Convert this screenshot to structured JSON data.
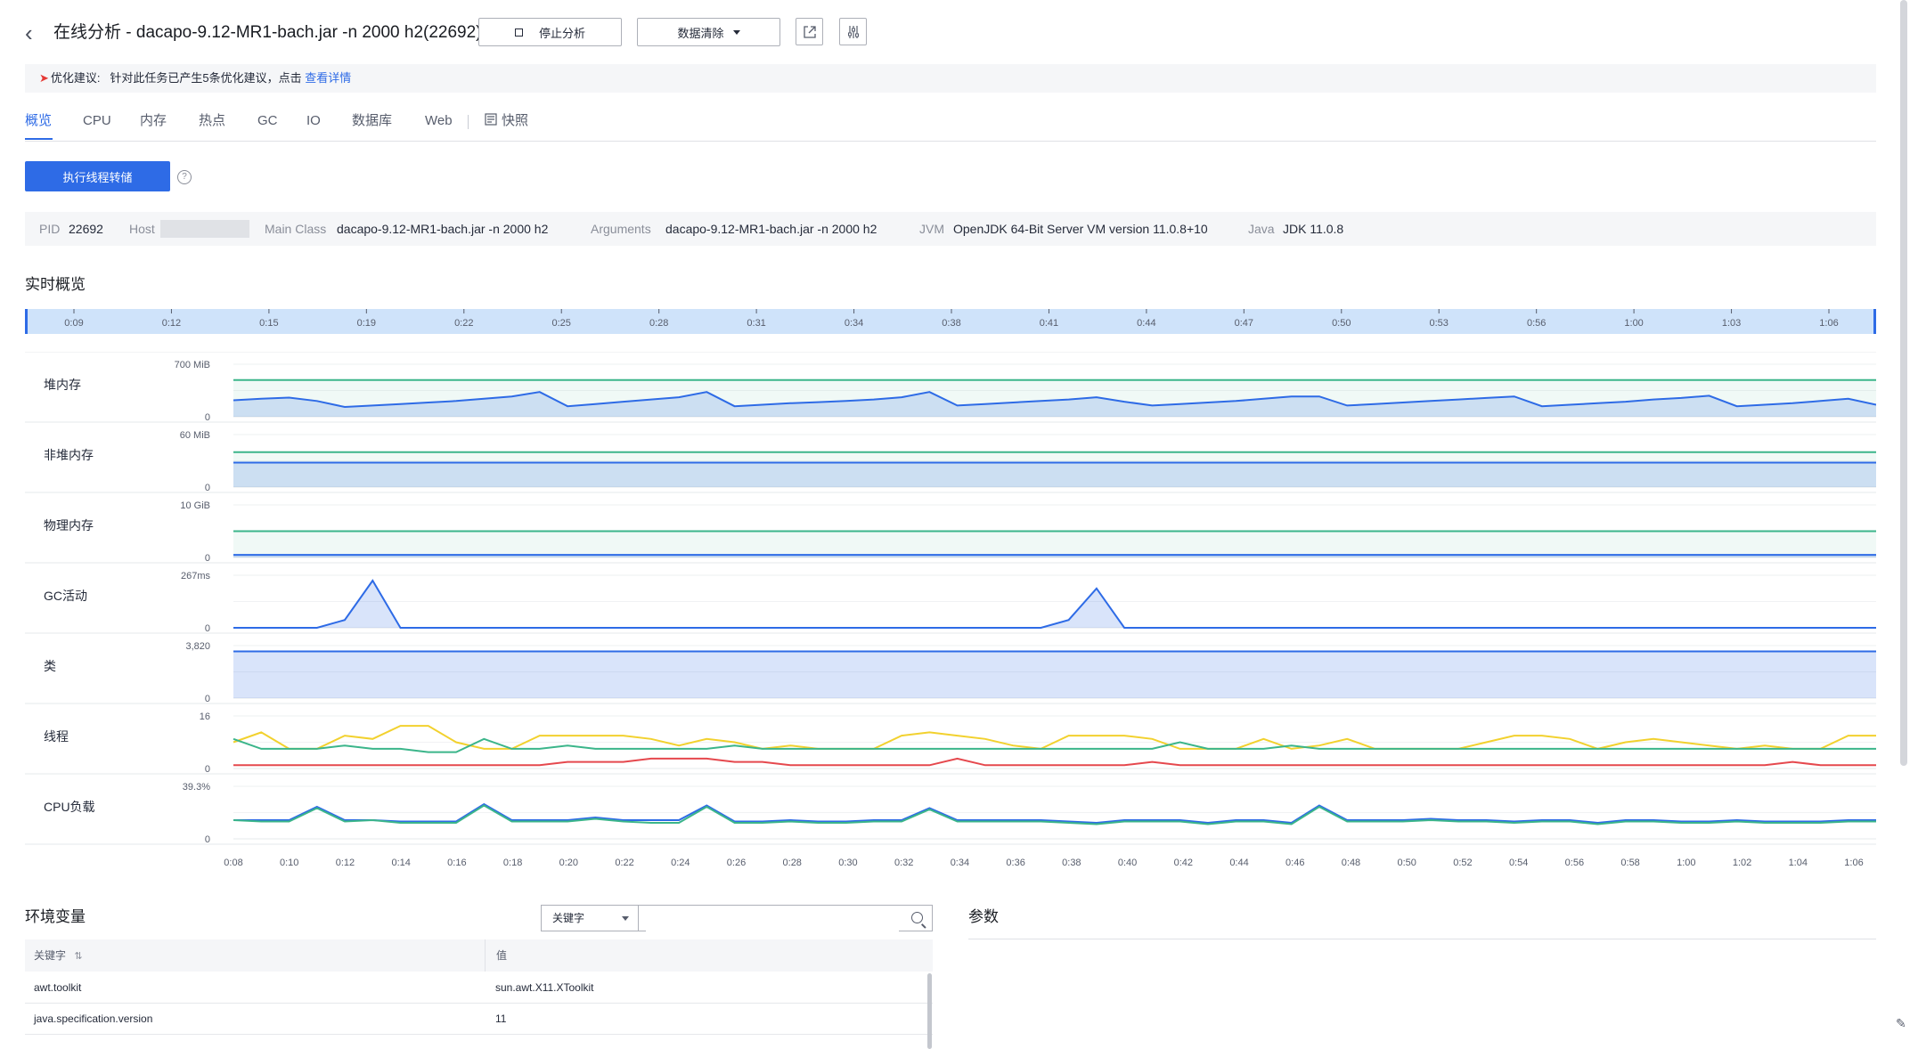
{
  "header": {
    "title": "在线分析 - dacapo-9.12-MR1-bach.jar -n 2000 h2(22692)",
    "stop_label": "停止分析",
    "clear_label": "数据清除",
    "icon_names": [
      "back-icon",
      "external-link-icon",
      "settings-sliders-icon"
    ]
  },
  "suggestion": {
    "prefix": "优化建议:",
    "text": "针对此任务已产生5条优化建议，点击",
    "link": "查看详情"
  },
  "tabs": [
    {
      "label": "概览",
      "active": true
    },
    {
      "label": "CPU"
    },
    {
      "label": "内存"
    },
    {
      "label": "热点"
    },
    {
      "label": "GC"
    },
    {
      "label": "IO"
    },
    {
      "label": "数据库"
    },
    {
      "label": "Web"
    },
    {
      "label": "快照"
    }
  ],
  "thread_dump_label": "执行线程转储",
  "help_glyph": "?",
  "info": {
    "pid_label": "PID",
    "pid": "22692",
    "host_label": "Host",
    "main_class_label": "Main Class",
    "main_class": "dacapo-9.12-MR1-bach.jar -n 2000 h2",
    "arguments_label": "Arguments",
    "arguments": "dacapo-9.12-MR1-bach.jar -n 2000 h2",
    "jvm_label": "JVM",
    "jvm": "OpenJDK 64-Bit Server VM version 11.0.8+10",
    "java_label": "Java",
    "java": "JDK 11.0.8"
  },
  "realtime_title": "实时概览",
  "timeline_ticks": [
    "0:09",
    "0:12",
    "0:15",
    "0:19",
    "0:22",
    "0:25",
    "0:28",
    "0:31",
    "0:34",
    "0:38",
    "0:41",
    "0:44",
    "0:47",
    "0:50",
    "0:53",
    "0:56",
    "1:00",
    "1:03",
    "1:06"
  ],
  "x_ticks": [
    "0:08",
    "0:10",
    "0:12",
    "0:14",
    "0:16",
    "0:18",
    "0:20",
    "0:22",
    "0:24",
    "0:26",
    "0:28",
    "0:30",
    "0:32",
    "0:34",
    "0:36",
    "0:38",
    "0:40",
    "0:42",
    "0:44",
    "0:46",
    "0:48",
    "0:50",
    "0:52",
    "0:54",
    "0:56",
    "0:58",
    "1:00",
    "1:02",
    "1:04",
    "1:06"
  ],
  "colors": {
    "blue": "#2e6be6",
    "green": "#3bb58a",
    "yellow": "#f2d12e",
    "red": "#e5484d"
  },
  "chart_data": [
    {
      "type": "area",
      "title": "堆内存",
      "ymax": "700 MiB",
      "ymin": "0",
      "ylim": [
        0,
        700
      ],
      "series": [
        {
          "color": "green",
          "values": [
            490,
            490,
            490,
            490,
            490,
            490,
            490,
            490,
            490,
            490,
            490,
            490,
            490,
            490,
            490,
            490,
            490,
            490,
            490,
            490,
            490,
            490,
            490,
            490,
            490,
            490,
            490,
            490,
            490,
            490,
            490,
            490,
            490,
            490,
            490,
            490,
            490,
            490,
            490,
            490,
            490,
            490,
            490,
            490,
            490,
            490,
            490,
            490,
            490,
            490,
            490,
            490,
            490,
            490,
            490,
            490,
            490,
            490,
            490,
            490
          ]
        },
        {
          "color": "blue",
          "values": [
            220,
            240,
            255,
            210,
            130,
            150,
            170,
            190,
            210,
            240,
            270,
            330,
            140,
            170,
            200,
            230,
            260,
            330,
            140,
            160,
            180,
            195,
            210,
            230,
            260,
            330,
            150,
            170,
            190,
            210,
            230,
            260,
            200,
            150,
            170,
            190,
            210,
            240,
            270,
            270,
            150,
            170,
            190,
            210,
            230,
            250,
            270,
            140,
            160,
            180,
            200,
            230,
            250,
            280,
            140,
            160,
            180,
            210,
            240,
            160
          ]
        }
      ]
    },
    {
      "type": "area",
      "title": "非堆内存",
      "ymax": "60 MiB",
      "ymin": "0",
      "ylim": [
        0,
        60
      ],
      "series": [
        {
          "color": "green",
          "values": [
            40,
            40,
            40,
            40,
            40,
            40,
            40,
            40,
            40,
            40,
            40,
            40,
            40,
            40,
            40,
            40,
            40,
            40,
            40,
            40,
            40,
            40,
            40,
            40,
            40,
            40,
            40,
            40,
            40,
            40,
            40,
            40,
            40,
            40,
            40,
            40,
            40,
            40,
            40,
            40,
            40,
            40,
            40,
            40,
            40,
            40,
            40,
            40,
            40,
            40,
            40,
            40,
            40,
            40,
            40,
            40,
            40,
            40,
            40,
            40
          ]
        },
        {
          "color": "blue",
          "values": [
            28,
            28,
            28,
            28,
            28,
            28,
            28,
            28,
            28,
            28,
            28,
            28,
            28,
            28,
            28,
            28,
            28,
            28,
            28,
            28,
            28,
            28,
            28,
            28,
            28,
            28,
            28,
            28,
            28,
            28,
            28,
            28,
            28,
            28,
            28,
            28,
            28,
            28,
            28,
            28,
            28,
            28,
            28,
            28,
            28,
            28,
            28,
            28,
            28,
            28,
            28,
            28,
            28,
            28,
            28,
            28,
            28,
            28,
            28,
            28
          ]
        }
      ]
    },
    {
      "type": "area",
      "title": "物理内存",
      "ymax": "10 GiB",
      "ymin": "0",
      "ylim": [
        0,
        10
      ],
      "series": [
        {
          "color": "green",
          "values": [
            5,
            5,
            5,
            5,
            5,
            5,
            5,
            5,
            5,
            5,
            5,
            5,
            5,
            5,
            5,
            5,
            5,
            5,
            5,
            5,
            5,
            5,
            5,
            5,
            5,
            5,
            5,
            5,
            5,
            5,
            5,
            5,
            5,
            5,
            5,
            5,
            5,
            5,
            5,
            5,
            5,
            5,
            5,
            5,
            5,
            5,
            5,
            5,
            5,
            5,
            5,
            5,
            5,
            5,
            5,
            5,
            5,
            5,
            5,
            5
          ]
        },
        {
          "color": "blue",
          "values": [
            0.5,
            0.5,
            0.5,
            0.5,
            0.5,
            0.5,
            0.5,
            0.5,
            0.5,
            0.5,
            0.5,
            0.5,
            0.5,
            0.5,
            0.5,
            0.5,
            0.5,
            0.5,
            0.5,
            0.5,
            0.5,
            0.5,
            0.5,
            0.5,
            0.5,
            0.5,
            0.5,
            0.5,
            0.5,
            0.5,
            0.5,
            0.5,
            0.5,
            0.5,
            0.5,
            0.5,
            0.5,
            0.5,
            0.5,
            0.5,
            0.5,
            0.5,
            0.5,
            0.5,
            0.5,
            0.5,
            0.5,
            0.5,
            0.5,
            0.5,
            0.5,
            0.5,
            0.5,
            0.5,
            0.5,
            0.5,
            0.5,
            0.5,
            0.5,
            0.5
          ]
        }
      ]
    },
    {
      "type": "area",
      "title": "GC活动",
      "ymax": "267ms",
      "ymin": "0",
      "ylim": [
        0,
        267
      ],
      "series": [
        {
          "color": "blue",
          "values": [
            0,
            0,
            0,
            0,
            40,
            240,
            0,
            0,
            0,
            0,
            0,
            0,
            0,
            0,
            0,
            0,
            0,
            0,
            0,
            0,
            0,
            0,
            0,
            0,
            0,
            0,
            0,
            0,
            0,
            0,
            40,
            200,
            0,
            0,
            0,
            0,
            0,
            0,
            0,
            0,
            0,
            0,
            0,
            0,
            0,
            0,
            0,
            0,
            0,
            0,
            0,
            0,
            0,
            0,
            0,
            0,
            0,
            0,
            0,
            0
          ]
        }
      ]
    },
    {
      "type": "area",
      "title": "类",
      "ymax": "3,820",
      "ymin": "0",
      "ylim": [
        0,
        3820
      ],
      "series": [
        {
          "color": "blue",
          "values": [
            3400,
            3400
          ]
        }
      ]
    },
    {
      "type": "line",
      "title": "线程",
      "ymax": "16",
      "ymin": "0",
      "ylim": [
        0,
        16
      ],
      "series": [
        {
          "color": "yellow",
          "values": [
            8,
            11,
            6,
            6,
            10,
            9,
            13,
            13,
            8,
            6,
            6,
            10,
            10,
            10,
            10,
            9,
            7,
            9,
            8,
            6,
            7,
            6,
            6,
            6,
            10,
            11,
            10,
            9,
            7,
            6,
            10,
            10,
            10,
            9,
            6,
            6,
            6,
            9,
            6,
            7,
            9,
            6,
            6,
            6,
            6,
            8,
            10,
            10,
            9,
            6,
            8,
            9,
            8,
            7,
            6,
            7,
            6,
            6,
            10,
            10
          ]
        },
        {
          "color": "green",
          "values": [
            9,
            6,
            6,
            6,
            7,
            6,
            6,
            5,
            5,
            9,
            6,
            6,
            7,
            6,
            6,
            6,
            6,
            6,
            7,
            6,
            6,
            6,
            6,
            6,
            6,
            6,
            6,
            6,
            6,
            6,
            6,
            6,
            6,
            6,
            8,
            6,
            6,
            6,
            7,
            6,
            6,
            6,
            6,
            6,
            6,
            6,
            6,
            6,
            6,
            6,
            6,
            6,
            6,
            6,
            6,
            6,
            6,
            6,
            6,
            6
          ]
        },
        {
          "color": "red",
          "values": [
            1,
            1,
            1,
            1,
            1,
            1,
            1,
            1,
            1,
            1,
            1,
            1,
            2,
            2,
            2,
            3,
            3,
            3,
            2,
            2,
            1,
            1,
            1,
            1,
            1,
            1,
            3,
            1,
            1,
            1,
            1,
            1,
            1,
            2,
            1,
            1,
            1,
            1,
            1,
            1,
            1,
            1,
            1,
            1,
            1,
            1,
            1,
            1,
            1,
            1,
            1,
            1,
            1,
            1,
            1,
            1,
            2,
            1,
            1,
            1
          ]
        }
      ]
    },
    {
      "type": "line",
      "title": "CPU负载",
      "ymax": "39.3%",
      "ymin": "0",
      "ylim": [
        0,
        39.3
      ],
      "series": [
        {
          "color": "blue",
          "values": [
            14,
            14,
            14,
            24,
            14,
            14,
            13,
            13,
            13,
            26,
            14,
            14,
            14,
            16,
            14,
            14,
            14,
            25,
            13,
            13,
            14,
            13,
            13,
            14,
            14,
            23,
            14,
            14,
            14,
            14,
            13,
            12,
            14,
            14,
            14,
            12,
            14,
            14,
            12,
            25,
            14,
            14,
            14,
            15,
            14,
            14,
            13,
            14,
            14,
            12,
            14,
            14,
            13,
            13,
            14,
            13,
            13,
            13,
            14,
            14
          ]
        },
        {
          "color": "green",
          "values": [
            14,
            13,
            13,
            23,
            13,
            14,
            12,
            12,
            12,
            25,
            13,
            13,
            13,
            15,
            13,
            12,
            12,
            24,
            12,
            12,
            13,
            12,
            12,
            13,
            13,
            22,
            13,
            13,
            13,
            13,
            12,
            11,
            13,
            13,
            13,
            11,
            13,
            13,
            11,
            24,
            13,
            13,
            13,
            14,
            13,
            13,
            12,
            13,
            13,
            11,
            13,
            13,
            12,
            12,
            13,
            12,
            12,
            12,
            13,
            13
          ]
        }
      ]
    }
  ],
  "env": {
    "title": "环境变量",
    "select_value": "关键字",
    "search_placeholder": "",
    "col_key": "关键字",
    "col_value": "值",
    "rows": [
      {
        "key": "awt.toolkit",
        "value": "sun.awt.X11.XToolkit"
      },
      {
        "key": "java.specification.version",
        "value": "11"
      }
    ]
  },
  "params_title": "参数"
}
